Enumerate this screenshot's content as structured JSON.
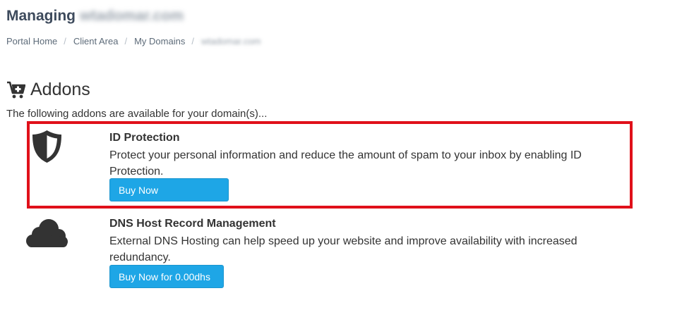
{
  "header": {
    "title_prefix": "Managing",
    "domain_blurred": "wtadomar.com"
  },
  "breadcrumb": {
    "items": [
      "Portal Home",
      "Client Area",
      "My Domains"
    ],
    "separator": "/",
    "current_blurred": "wtadomar.com"
  },
  "section": {
    "title": "Addons",
    "intro": "The following addons are available for your domain(s)..."
  },
  "addons": [
    {
      "name": "ID Protection",
      "description": "Protect your personal information and reduce the amount of spam to your inbox by enabling ID Protection.",
      "button_label": "Buy Now",
      "icon": "shield-icon"
    },
    {
      "name": "DNS Host Record Management",
      "description": "External DNS Hosting can help speed up your website and improve availability with increased redundancy.",
      "button_label": "Buy Now for 0.00dhs",
      "icon": "cloud-icon"
    }
  ],
  "colors": {
    "button": "#1ea6e6",
    "highlight": "#e0101a",
    "icon": "#333333",
    "title": "#3d4a5c"
  }
}
